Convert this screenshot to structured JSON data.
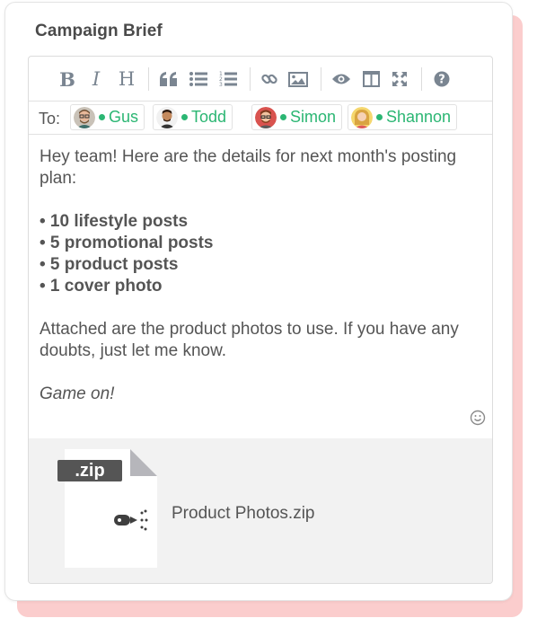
{
  "card": {
    "title": "Campaign Brief"
  },
  "toolbar": {
    "buttons": [
      {
        "name": "bold-icon"
      },
      {
        "name": "italic-icon"
      },
      {
        "name": "heading-icon"
      },
      {
        "name": "quote-icon"
      },
      {
        "name": "bullet-list-icon"
      },
      {
        "name": "numbered-list-icon"
      },
      {
        "name": "link-icon"
      },
      {
        "name": "image-icon"
      },
      {
        "name": "preview-icon"
      },
      {
        "name": "side-by-side-icon"
      },
      {
        "name": "fullscreen-icon"
      },
      {
        "name": "help-icon"
      }
    ],
    "labels": {
      "bold": "B",
      "italic": "I",
      "heading": "H"
    }
  },
  "recipients": {
    "label": "To:",
    "people": [
      {
        "name": "Gus",
        "status": "online"
      },
      {
        "name": "Todd",
        "status": "online"
      },
      {
        "name": "Simon",
        "status": "online"
      },
      {
        "name": "Shannon",
        "status": "online"
      }
    ]
  },
  "message": {
    "intro": "Hey team! Here are the details for next month's posting plan:",
    "items": [
      "• 10 lifestyle posts",
      "• 5 promotional posts",
      "• 5 product posts",
      "• 1 cover photo"
    ],
    "body": "Attached are the product photos to use. If you have any doubts, just let me know.",
    "signoff": "Game on!"
  },
  "attachment": {
    "badge": ".zip",
    "file_name": "Product Photos.zip"
  },
  "colors": {
    "accent_green": "#2bb673",
    "shadow_pink": "#fbcdcd",
    "icon_gray": "#7a8591"
  }
}
